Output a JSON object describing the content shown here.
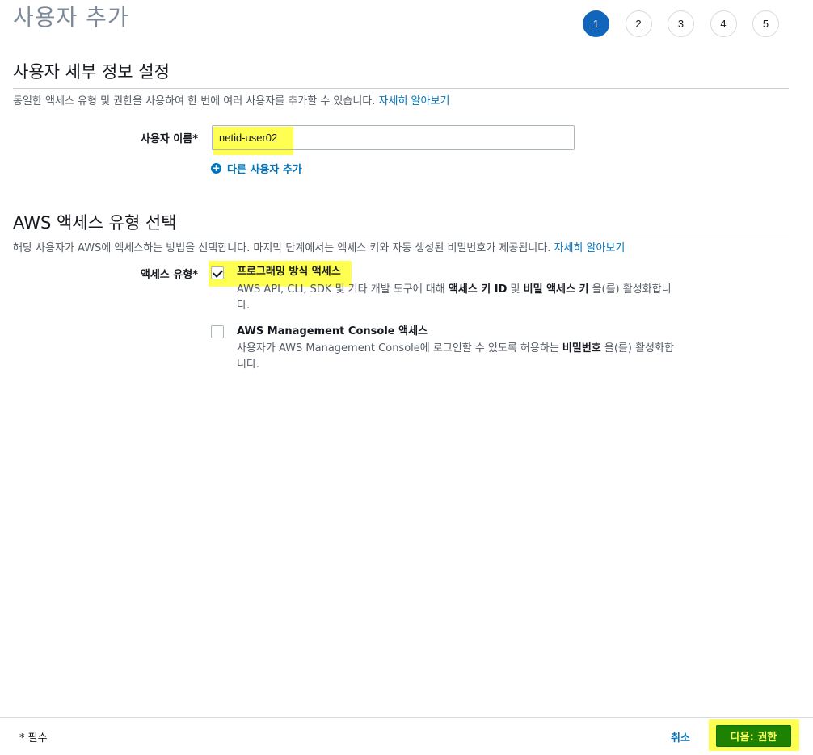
{
  "header": {
    "title": "사용자 추가",
    "steps": [
      "1",
      "2",
      "3",
      "4",
      "5"
    ],
    "active_step": "1"
  },
  "user_details": {
    "title": "사용자 세부 정보 설정",
    "description": "동일한 액세스 유형 및 권한을 사용하여 한 번에 여러 사용자를 추가할 수 있습니다.",
    "learn_more": "자세히 알아보기",
    "username_label": "사용자 이름*",
    "username_value": "netid-user02",
    "add_user_label": "다른 사용자 추가"
  },
  "access_type": {
    "title": "AWS 액세스 유형 선택",
    "description": "해당 사용자가 AWS에 액세스하는 방법을 선택합니다. 마지막 단계에서는 액세스 키와 자동 생성된 비밀번호가 제공됩니다.",
    "learn_more": "자세히 알아보기",
    "label": "액세스 유형*",
    "programmatic": {
      "title": "프로그래밍 방식 액세스",
      "desc_pre": "AWS API, CLI, SDK 및 기타 개발 도구에 대해 ",
      "desc_bold1": "액세스 키 ID",
      "desc_mid": " 및 ",
      "desc_bold2": "비밀 액세스 키",
      "desc_post": " 을(를) 활성화합니다.",
      "checked": true
    },
    "console": {
      "title": "AWS Management Console 액세스",
      "desc_pre": "사용자가 AWS Management Console에 로그인할 수 있도록 허용하는 ",
      "desc_bold": "비밀번호",
      "desc_post": " 을(를) 활성화합니다.",
      "checked": false
    }
  },
  "footer": {
    "required_note": "* 필수",
    "cancel_label": "취소",
    "next_label": "다음: 권한"
  },
  "colors": {
    "primary": "#1166bb",
    "link": "#0073bb",
    "next_button": "#1d8102",
    "highlight": "#ffff33"
  }
}
